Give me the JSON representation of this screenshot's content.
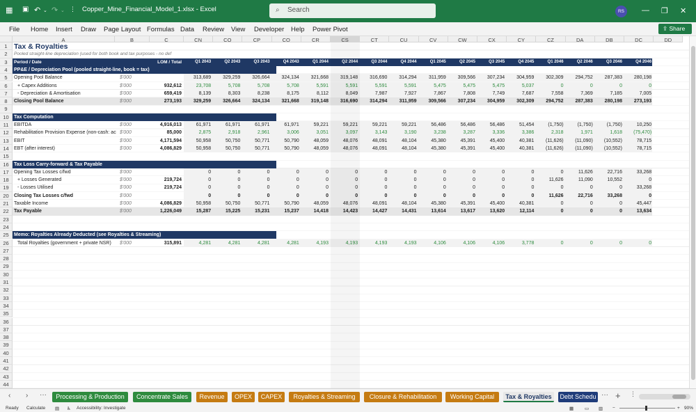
{
  "app": {
    "file_name": "Copper_Mine_Financial_Model_1.xlsx - Excel",
    "search_placeholder": "Search",
    "user_initials": "RS"
  },
  "menu": [
    "File",
    "Home",
    "Insert",
    "Draw",
    "Page Layout",
    "Formulas",
    "Data",
    "Review",
    "View",
    "Developer",
    "Help",
    "Power Pivot"
  ],
  "share_label": "Share",
  "col_letters": [
    "A",
    "B",
    "C",
    "CN",
    "CO",
    "CP",
    "CQ",
    "CR",
    "CS",
    "CT",
    "CU",
    "CV",
    "CW",
    "CX",
    "CY",
    "CZ",
    "DA",
    "DB",
    "DC",
    "DD"
  ],
  "sheet": {
    "title": "Tax & Royalties",
    "subtitle": "Pooled straight-line depreciation (used for both book and tax purposes - no def",
    "header_row": {
      "label": "Period / Date",
      "c": "LOM / Total",
      "periods": [
        "Q1 2043",
        "Q2 2043",
        "Q3 2043",
        "Q4 2043",
        "Q1 2044",
        "Q2 2044",
        "Q3 2044",
        "Q4 2044",
        "Q1 2045",
        "Q2 2045",
        "Q3 2045",
        "Q4 2045",
        "Q1 2046",
        "Q2 2046",
        "Q3 2046",
        "Q4 2046"
      ]
    },
    "rows": [
      {
        "r": 4,
        "type": "section",
        "label": "PP&E / Depreciation Pool (pooled straight-line, book = tax)"
      },
      {
        "r": 5,
        "label": "Opening Pool Balance",
        "unit": "$'000",
        "c": "",
        "v": [
          "313,689",
          "329,259",
          "326,664",
          "324,134",
          "321,668",
          "319,148",
          "316,690",
          "314,294",
          "311,959",
          "309,566",
          "307,234",
          "304,959",
          "302,309",
          "294,752",
          "287,383",
          "280,198"
        ]
      },
      {
        "r": 6,
        "label": "+ Capex Additions",
        "indent": true,
        "unit": "$'000",
        "c": "932,612",
        "green": true,
        "v": [
          "23,708",
          "5,708",
          "5,708",
          "5,708",
          "5,591",
          "5,591",
          "5,591",
          "5,591",
          "5,475",
          "5,475",
          "5,475",
          "5,037",
          "0",
          "0",
          "0",
          "0"
        ]
      },
      {
        "r": 7,
        "label": "- Depreciation & Amortisation",
        "indent": true,
        "unit": "$'000",
        "c": "659,419",
        "v": [
          "8,139",
          "8,303",
          "8,238",
          "8,175",
          "8,112",
          "8,049",
          "7,987",
          "7,927",
          "7,867",
          "7,808",
          "7,749",
          "7,687",
          "7,558",
          "7,369",
          "7,185",
          "7,005"
        ]
      },
      {
        "r": 8,
        "label": "Closing Pool Balance",
        "bold": true,
        "total": true,
        "unit": "$'000",
        "c": "273,193",
        "v": [
          "329,259",
          "326,664",
          "324,134",
          "321,668",
          "319,148",
          "316,690",
          "314,294",
          "311,959",
          "309,566",
          "307,234",
          "304,959",
          "302,309",
          "294,752",
          "287,383",
          "280,198",
          "273,193"
        ]
      },
      {
        "r": 9,
        "label": ""
      },
      {
        "r": 10,
        "type": "section",
        "label": "Tax Computation"
      },
      {
        "r": 11,
        "label": "EBITDA",
        "unit": "$'000",
        "c": "4,916,013",
        "v": [
          "61,971",
          "61,971",
          "61,971",
          "61,971",
          "59,221",
          "59,221",
          "59,221",
          "59,221",
          "56,486",
          "56,486",
          "56,486",
          "51,454",
          "(1,750)",
          "(1,750)",
          "(1,750)",
          "10,250"
        ]
      },
      {
        "r": 12,
        "label": "Rehabilitation Provision Expense (non-cash: ac",
        "unit": "$'000",
        "c": "85,000",
        "green": true,
        "v": [
          "2,875",
          "2,918",
          "2,961",
          "3,006",
          "3,051",
          "3,097",
          "3,143",
          "3,190",
          "3,238",
          "3,287",
          "3,336",
          "3,386",
          "2,318",
          "1,971",
          "1,618",
          "(75,470)"
        ]
      },
      {
        "r": 13,
        "label": "EBIT",
        "unit": "$'000",
        "c": "4,171,594",
        "v": [
          "50,958",
          "50,750",
          "50,771",
          "50,790",
          "48,059",
          "48,076",
          "48,091",
          "48,104",
          "45,380",
          "45,391",
          "45,400",
          "40,381",
          "(11,626)",
          "(11,090)",
          "(10,552)",
          "78,715"
        ]
      },
      {
        "r": 14,
        "label": "EBT (after interest)",
        "unit": "$'000",
        "c": "4,086,829",
        "v": [
          "50,958",
          "50,750",
          "50,771",
          "50,790",
          "48,059",
          "48,076",
          "48,091",
          "48,104",
          "45,380",
          "45,391",
          "45,400",
          "40,381",
          "(11,626)",
          "(11,090)",
          "(10,552)",
          "78,715"
        ]
      },
      {
        "r": 15,
        "label": ""
      },
      {
        "r": 16,
        "type": "section",
        "label": "Tax Loss Carry-forward & Tax Payable"
      },
      {
        "r": 17,
        "label": "Opening Tax Losses c/fwd",
        "unit": "$'000",
        "c": "",
        "v": [
          "0",
          "0",
          "0",
          "0",
          "0",
          "0",
          "0",
          "0",
          "0",
          "0",
          "0",
          "0",
          "0",
          "11,626",
          "22,716",
          "33,268"
        ]
      },
      {
        "r": 18,
        "label": "+ Losses Generated",
        "indent": true,
        "unit": "$'000",
        "c": "219,724",
        "v": [
          "0",
          "0",
          "0",
          "0",
          "0",
          "0",
          "0",
          "0",
          "0",
          "0",
          "0",
          "0",
          "11,626",
          "11,090",
          "10,552",
          "0"
        ]
      },
      {
        "r": 19,
        "label": "- Losses Utilised",
        "indent": true,
        "unit": "$'000",
        "c": "219,724",
        "v": [
          "0",
          "0",
          "0",
          "0",
          "0",
          "0",
          "0",
          "0",
          "0",
          "0",
          "0",
          "0",
          "0",
          "0",
          "0",
          "33,268"
        ]
      },
      {
        "r": 20,
        "label": "Closing Tax Losses c/fwd",
        "bold": true,
        "unit": "$'000",
        "c": "",
        "v": [
          "0",
          "0",
          "0",
          "0",
          "0",
          "0",
          "0",
          "0",
          "0",
          "0",
          "0",
          "0",
          "11,626",
          "22,716",
          "33,268",
          "0"
        ]
      },
      {
        "r": 21,
        "label": "Taxable Income",
        "unit": "$'000",
        "c": "4,086,829",
        "v": [
          "50,958",
          "50,750",
          "50,771",
          "50,790",
          "48,059",
          "48,076",
          "48,091",
          "48,104",
          "45,380",
          "45,391",
          "45,400",
          "40,381",
          "0",
          "0",
          "0",
          "45,447"
        ]
      },
      {
        "r": 22,
        "label": "Tax Payable",
        "bold": true,
        "total": true,
        "unit": "$'000",
        "c": "1,226,049",
        "v": [
          "15,287",
          "15,225",
          "15,231",
          "15,237",
          "14,418",
          "14,423",
          "14,427",
          "14,431",
          "13,614",
          "13,617",
          "13,620",
          "12,114",
          "0",
          "0",
          "0",
          "13,634"
        ]
      },
      {
        "r": 23,
        "label": ""
      },
      {
        "r": 24,
        "label": ""
      },
      {
        "r": 25,
        "type": "section",
        "label": "Memo: Royalties Already Deducted (see Royalties & Streaming)"
      },
      {
        "r": 26,
        "label": "Total Royalties (government + private NSR)",
        "indent": true,
        "unit": "$'000",
        "c": "315,891",
        "green": true,
        "v": [
          "4,281",
          "4,281",
          "4,281",
          "4,281",
          "4,193",
          "4,193",
          "4,193",
          "4,193",
          "4,106",
          "4,106",
          "4,106",
          "3,778",
          "0",
          "0",
          "0",
          "0"
        ]
      }
    ],
    "empty_rows": [
      27,
      28,
      29,
      30,
      31,
      32,
      33,
      34,
      35,
      36,
      37,
      38,
      39,
      40,
      41,
      42
    ]
  },
  "tabs": [
    {
      "label": "Processing & Production",
      "color": "#2e8b3e"
    },
    {
      "label": "Concentrate Sales",
      "color": "#2e8b3e"
    },
    {
      "label": "Revenue",
      "color": "#c57b12"
    },
    {
      "label": "OPEX",
      "color": "#c57b12"
    },
    {
      "label": "CAPEX",
      "color": "#c57b12"
    },
    {
      "label": "Royalties & Streaming",
      "color": "#c57b12"
    },
    {
      "label": "Closure & Rehabilitation",
      "color": "#c57b12"
    },
    {
      "label": "Working Capital",
      "color": "#c57b12"
    },
    {
      "label": "Tax & Royalties",
      "color": "#e8e8e8",
      "active": true
    },
    {
      "label": "Debt Schedu",
      "color": "#1f3c7a"
    }
  ],
  "status": {
    "ready": "Ready",
    "calculate": "Calculate",
    "accessibility": "Accessibility: Investigate",
    "zoom": "90%"
  },
  "colors": {
    "excel_green": "#1f7a45",
    "section_navy": "#1f3864",
    "input_green": "#2e8b3e"
  }
}
